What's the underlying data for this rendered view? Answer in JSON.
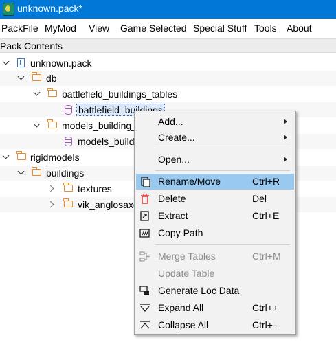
{
  "window": {
    "title": "unknown.pack*"
  },
  "menubar": {
    "items": [
      "PackFile",
      "MyMod",
      "View",
      "Game Selected",
      "Special Stuff",
      "Tools",
      "About"
    ]
  },
  "dock": {
    "title": "Pack Contents"
  },
  "tree": {
    "items": [
      "unknown.pack",
      "db",
      "battlefield_buildings_tables",
      "battlefield_buildings",
      "models_building_",
      "models_build",
      "rigidmodels",
      "buildings",
      "textures",
      "vik_anglosaxo"
    ]
  },
  "context_menu": {
    "items": [
      {
        "label": "Add...",
        "shortcut": "",
        "icon": "none",
        "submenu": true
      },
      {
        "label": "Create...",
        "shortcut": "",
        "icon": "none",
        "submenu": true
      },
      {
        "label": "Open...",
        "shortcut": "",
        "icon": "none",
        "submenu": true
      },
      {
        "label": "Rename/Move",
        "shortcut": "Ctrl+R",
        "icon": "rename-icon"
      },
      {
        "label": "Delete",
        "shortcut": "Del",
        "icon": "trash-icon"
      },
      {
        "label": "Extract",
        "shortcut": "Ctrl+E",
        "icon": "extract-icon"
      },
      {
        "label": "Copy Path",
        "shortcut": "",
        "icon": "copy-path-icon"
      },
      {
        "label": "Merge Tables",
        "shortcut": "Ctrl+M",
        "icon": "merge-icon",
        "disabled": true
      },
      {
        "label": "Update Table",
        "shortcut": "",
        "icon": "none",
        "disabled": true
      },
      {
        "label": "Generate Loc Data",
        "shortcut": "",
        "icon": "generate-icon"
      },
      {
        "label": "Expand All",
        "shortcut": "Ctrl++",
        "icon": "expand-icon"
      },
      {
        "label": "Collapse All",
        "shortcut": "Ctrl+-",
        "icon": "collapse-icon"
      }
    ]
  },
  "colors": {
    "titlebar": "#0078d7",
    "folder": "#f08a24",
    "db_file": "#9a5bb5",
    "menu_highlight": "#99c9ef"
  }
}
